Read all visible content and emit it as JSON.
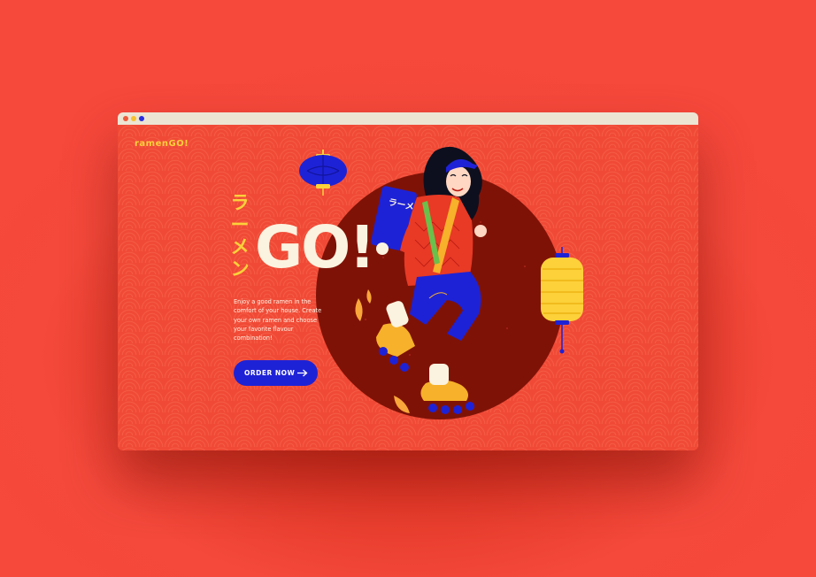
{
  "window": {
    "dots": [
      "#ef5a3a",
      "#f7c12e",
      "#2a2ee0"
    ]
  },
  "brand": {
    "logo": "ramenGO!",
    "colors": {
      "yellow": "#fcd13a",
      "red": "#f04a36",
      "blue": "#1e22d6",
      "cream": "#fbf3df",
      "dark_red": "#7f1207"
    }
  },
  "hero": {
    "kana": [
      "ラ",
      "ー",
      "メ",
      "ン"
    ],
    "title": "GO!",
    "description": "Enjoy a good ramen in the comfort of your house. Create your own ramen and choose your favorite flavour combination!",
    "cta_label": "ORDER NOW",
    "cta_icon": "arrow-right-icon"
  },
  "illustration": {
    "subject": "girl-on-roller-skates-with-ramen-delivery-box",
    "box_text": "ラーメン"
  }
}
